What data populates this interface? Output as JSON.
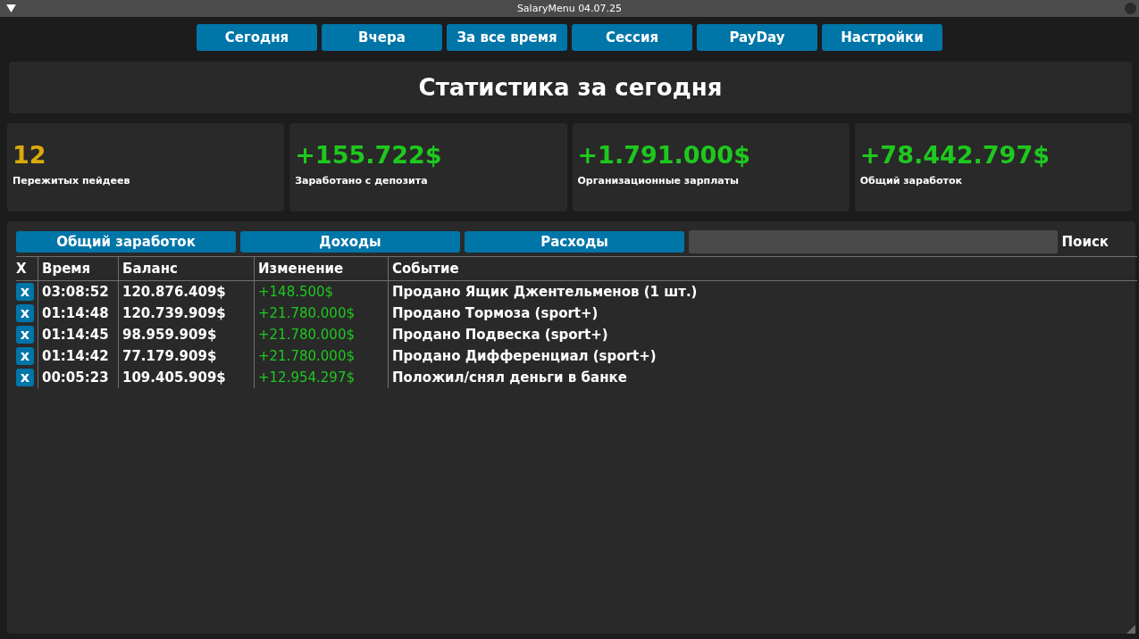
{
  "window": {
    "title": "SalaryMenu 04.07.25"
  },
  "nav": [
    {
      "label": "Сегодня"
    },
    {
      "label": "Вчера"
    },
    {
      "label": "За все время"
    },
    {
      "label": "Сессия"
    },
    {
      "label": "PayDay"
    },
    {
      "label": "Настройки"
    }
  ],
  "header": {
    "title": "Статистика за сегодня"
  },
  "stats": [
    {
      "value": "12",
      "label": "Пережитых пейдеев",
      "color": "#dcaa0a"
    },
    {
      "value": "+155.722$",
      "label": "Заработано с депозита",
      "color": "#1ec81e"
    },
    {
      "value": "+1.791.000$",
      "label": "Организационные зарплаты",
      "color": "#1ec81e"
    },
    {
      "value": "+78.442.797$",
      "label": "Общий заработок",
      "color": "#1ec81e"
    }
  ],
  "filters": [
    {
      "label": "Общий заработок"
    },
    {
      "label": "Доходы"
    },
    {
      "label": "Расходы"
    }
  ],
  "search": {
    "label": "Поиск"
  },
  "table": {
    "columns": [
      "X",
      "Время",
      "Баланс",
      "Изменение",
      "Событие"
    ],
    "rows": [
      {
        "delete": "x",
        "time": "03:08:52",
        "balance": "120.876.409$",
        "change": "+148.500$",
        "event": "Продано Ящик Джентельменов (1 шт.)"
      },
      {
        "delete": "x",
        "time": "01:14:48",
        "balance": "120.739.909$",
        "change": "+21.780.000$",
        "event": "Продано Тормоза (sport+)"
      },
      {
        "delete": "x",
        "time": "01:14:45",
        "balance": "98.959.909$",
        "change": "+21.780.000$",
        "event": "Продано Подвеска (sport+)"
      },
      {
        "delete": "x",
        "time": "01:14:42",
        "balance": "77.179.909$",
        "change": "+21.780.000$",
        "event": "Продано Дифференциал (sport+)"
      },
      {
        "delete": "x",
        "time": "00:05:23",
        "balance": "109.405.909$",
        "change": "+12.954.297$",
        "event": "Положил/снял деньги в банке"
      }
    ]
  }
}
